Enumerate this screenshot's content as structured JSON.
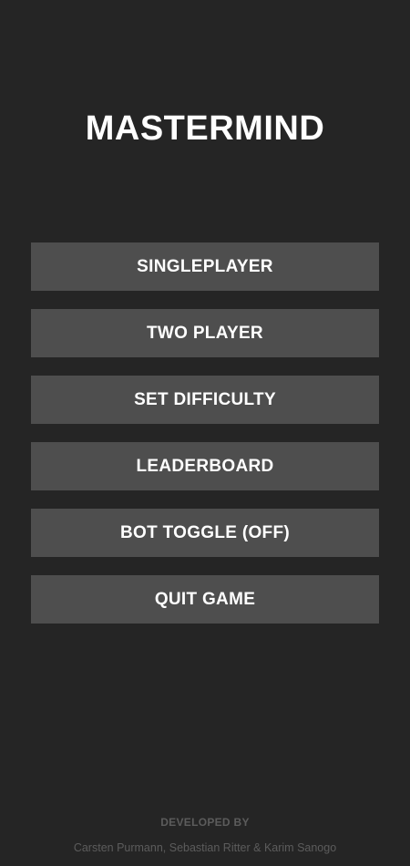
{
  "app": {
    "title": "MASTERMIND"
  },
  "menu": {
    "items": [
      {
        "label": "SINGLEPLAYER"
      },
      {
        "label": "TWO PLAYER"
      },
      {
        "label": "SET DIFFICULTY"
      },
      {
        "label": "LEADERBOARD"
      },
      {
        "label": "BOT TOGGLE (OFF)"
      },
      {
        "label": "QUIT GAME"
      }
    ]
  },
  "footer": {
    "heading": "DEVELOPED BY",
    "names": "Carsten Purmann, Sebastian Ritter & Karim Sanogo"
  },
  "colors": {
    "background": "#252525",
    "button": "#4e4e4e",
    "text": "#ffffff",
    "footer_text": "#5c5c5c"
  }
}
